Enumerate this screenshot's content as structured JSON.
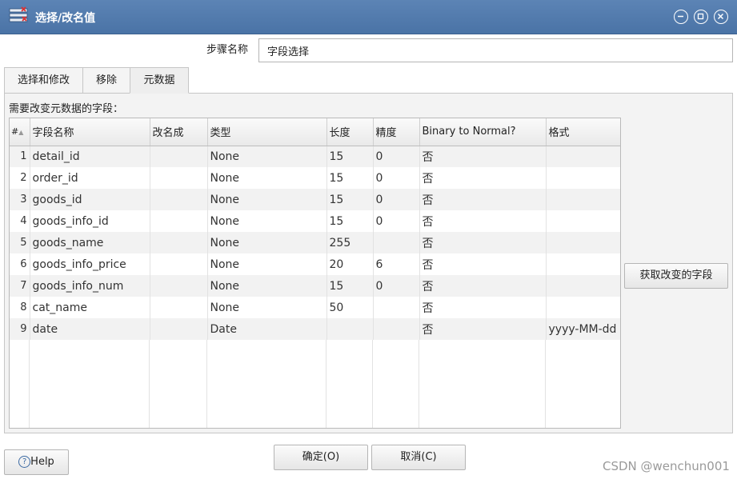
{
  "window": {
    "title": "选择/改名值"
  },
  "step": {
    "label": "步骤名称",
    "value": "字段选择"
  },
  "tabs": [
    {
      "label": "选择和修改"
    },
    {
      "label": "移除"
    },
    {
      "label": "元数据"
    }
  ],
  "panel": {
    "label": "需要改变元数据的字段："
  },
  "table": {
    "headers": [
      "#",
      "字段名称",
      "改名成",
      "类型",
      "长度",
      "精度",
      "Binary to Normal?",
      "格式"
    ],
    "rows": [
      {
        "num": "1",
        "name": "detail_id",
        "rename": "",
        "type": "None",
        "length": "15",
        "precision": "0",
        "binary": "否",
        "format": ""
      },
      {
        "num": "2",
        "name": "order_id",
        "rename": "",
        "type": "None",
        "length": "15",
        "precision": "0",
        "binary": "否",
        "format": ""
      },
      {
        "num": "3",
        "name": "goods_id",
        "rename": "",
        "type": "None",
        "length": "15",
        "precision": "0",
        "binary": "否",
        "format": ""
      },
      {
        "num": "4",
        "name": "goods_info_id",
        "rename": "",
        "type": "None",
        "length": "15",
        "precision": "0",
        "binary": "否",
        "format": ""
      },
      {
        "num": "5",
        "name": "goods_name",
        "rename": "",
        "type": "None",
        "length": "255",
        "precision": "",
        "binary": "否",
        "format": ""
      },
      {
        "num": "6",
        "name": "goods_info_price",
        "rename": "",
        "type": "None",
        "length": "20",
        "precision": "6",
        "binary": "否",
        "format": ""
      },
      {
        "num": "7",
        "name": "goods_info_num",
        "rename": "",
        "type": "None",
        "length": "15",
        "precision": "0",
        "binary": "否",
        "format": ""
      },
      {
        "num": "8",
        "name": "cat_name",
        "rename": "",
        "type": "None",
        "length": "50",
        "precision": "",
        "binary": "否",
        "format": ""
      },
      {
        "num": "9",
        "name": "date",
        "rename": "",
        "type": "Date",
        "length": "",
        "precision": "",
        "binary": "否",
        "format": "yyyy-MM-dd"
      }
    ]
  },
  "buttons": {
    "get_fields": "获取改变的字段",
    "ok": "确定(O)",
    "cancel": "取消(C)",
    "help": "Help"
  },
  "watermark": "CSDN @wenchun001",
  "icons": {
    "app": "table-edit-icon",
    "minimize": "minimize-icon",
    "maximize": "maximize-icon",
    "close": "close-icon",
    "help": "help-circle-icon",
    "sort": "sort-arrow-icon"
  },
  "colors": {
    "titlebar": "#4f78aa",
    "panel": "#f3f3f3",
    "odd_row": "#f2f2f2"
  }
}
